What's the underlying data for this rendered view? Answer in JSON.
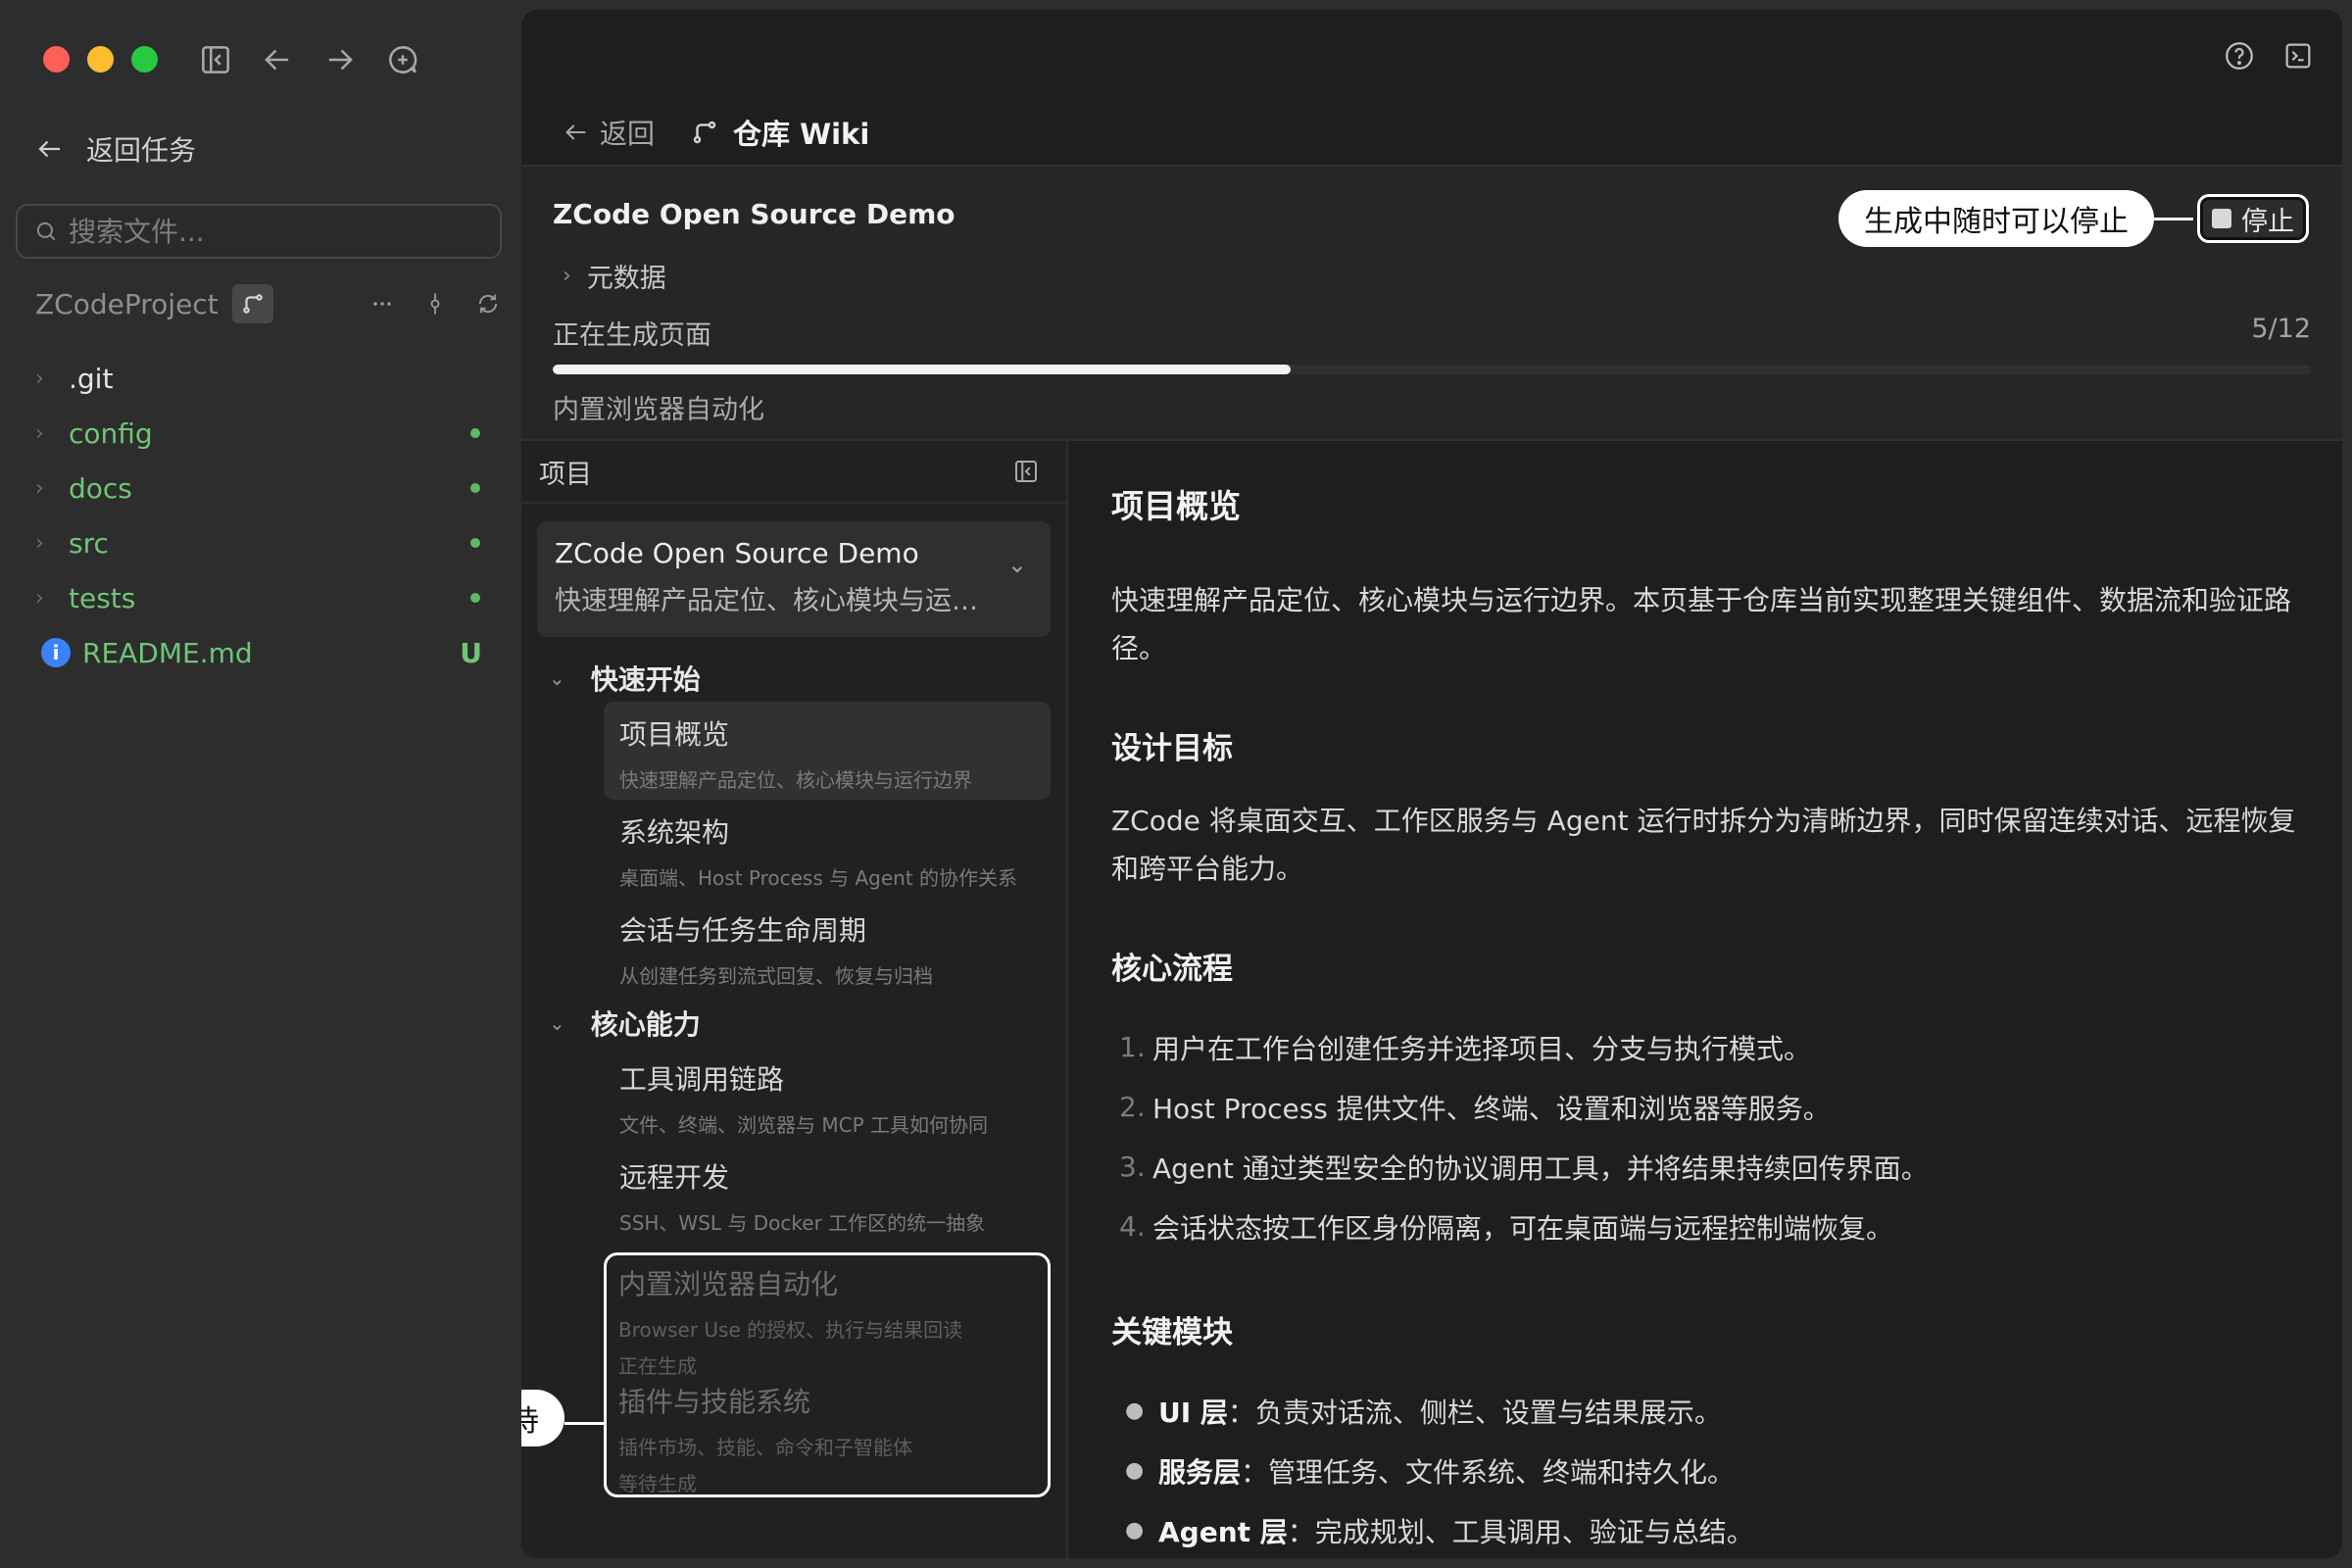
{
  "sidebar": {
    "back_label": "返回任务",
    "search_placeholder": "搜索文件...",
    "project_name": "ZCodeProject",
    "tree": [
      {
        "name": ".git",
        "status": ""
      },
      {
        "name": "config",
        "status": "modified"
      },
      {
        "name": "docs",
        "status": "modified"
      },
      {
        "name": "src",
        "status": "modified"
      },
      {
        "name": "tests",
        "status": "modified"
      },
      {
        "name": "README.md",
        "status": "U"
      }
    ]
  },
  "header": {
    "back_label": "返回",
    "title": "仓库 Wiki"
  },
  "generation": {
    "project_title": "ZCode Open Source Demo",
    "meta_label": "元数据",
    "status": "正在生成页面",
    "count": "5/12",
    "progress": 0.42,
    "current_page": "内置浏览器自动化",
    "stop_label": "停止",
    "stop_callout": "生成中随时可以停止"
  },
  "nav": {
    "header": "项目",
    "project_title": "ZCode Open Source Demo",
    "project_desc": "快速理解产品定位、核心模块与运行边界",
    "sections": [
      {
        "title": "快速开始",
        "pages": [
          {
            "title": "项目概览",
            "desc": "快速理解产品定位、核心模块与运行边界"
          },
          {
            "title": "系统架构",
            "desc": "桌面端、Host Process 与 Agent 的协作关系"
          },
          {
            "title": "会话与任务生命周期",
            "desc": "从创建任务到流式回复、恢复与归档"
          }
        ]
      },
      {
        "title": "核心能力",
        "pages": [
          {
            "title": "工具调用链路",
            "desc": "文件、终端、浏览器与 MCP 工具如何协同"
          },
          {
            "title": "远程开发",
            "desc": "SSH、WSL 与 Docker 工作区的统一抽象"
          },
          {
            "title": "内置浏览器自动化",
            "desc": "Browser Use 的授权、执行与结果回读",
            "state": "正在生成"
          },
          {
            "title": "插件与技能系统",
            "desc": "插件市场、技能、命令和子智能体",
            "state": "等待生成"
          }
        ]
      }
    ],
    "pending_callout": "未生成的显示等待"
  },
  "article": {
    "title": "项目概览",
    "intro": "快速理解产品定位、核心模块与运行边界。本页基于仓库当前实现整理关键组件、数据流和验证路径。",
    "design_title": "设计目标",
    "design_text": "ZCode 将桌面交互、工作区服务与 Agent 运行时拆分为清晰边界，同时保留连续对话、远程恢复和跨平台能力。",
    "flow_title": "核心流程",
    "flow": [
      "用户在工作台创建任务并选择项目、分支与执行模式。",
      "Host Process 提供文件、终端、设置和浏览器等服务。",
      "Agent 通过类型安全的协议调用工具，并将结果持续回传界面。",
      "会话状态按工作区身份隔离，可在桌面端与远程控制端恢复。"
    ],
    "modules_title": "关键模块",
    "modules": [
      {
        "name": "UI 层",
        "text": "：负责对话流、侧栏、设置与结果展示。"
      },
      {
        "name": "服务层",
        "text": "：管理任务、文件系统、终端和持久化。"
      },
      {
        "name": "Agent 层",
        "text": "：完成规划、工具调用、验证与总结。"
      }
    ]
  }
}
